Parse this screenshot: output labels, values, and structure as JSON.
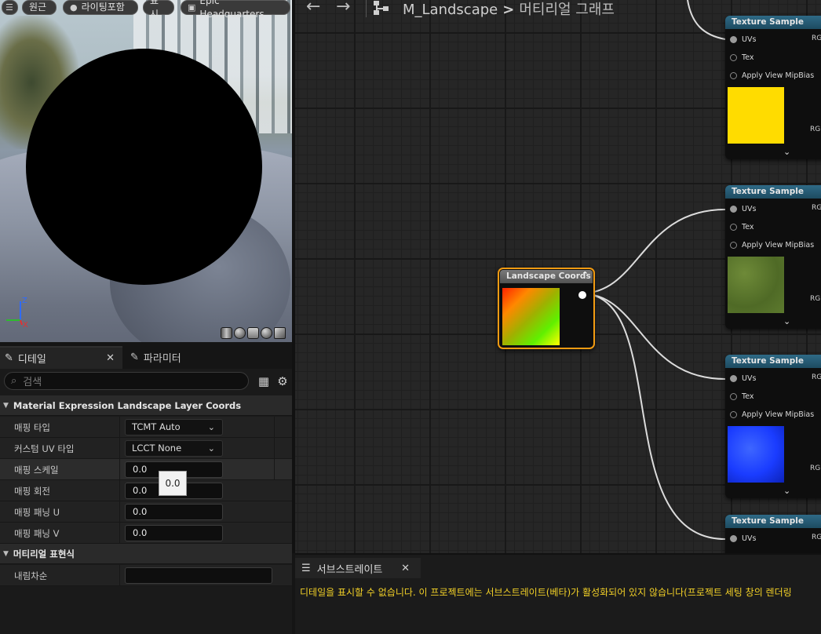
{
  "viewport": {
    "buttons": [
      {
        "label": "",
        "icon": "hamburger-menu-icon"
      },
      {
        "label": "원근",
        "icon": "perspective-icon"
      },
      {
        "label": "라이팅포함",
        "icon": "lit-sphere-icon"
      },
      {
        "label": "표시",
        "icon": ""
      },
      {
        "label": "Epic Headquarters",
        "icon": "image-icon"
      }
    ],
    "axis_labels": {
      "z": "Z",
      "x": "X"
    },
    "preview_shapes": [
      "cylinder-icon",
      "sphere-icon",
      "plane-icon",
      "sphere-icon",
      "cube-icon"
    ]
  },
  "details": {
    "tab_details": "디테일",
    "tab_parameters": "파라미터",
    "search_placeholder": "검색",
    "category1": "Material Expression Landscape Layer Coords",
    "rows": [
      {
        "label": "매핑 타입",
        "value": "TCMT Auto"
      },
      {
        "label": "커스텀 UV 타입",
        "value": "LCCT None"
      },
      {
        "label": "매핑 스케일",
        "value": "0.0"
      },
      {
        "label": "매핑 회전",
        "value": "0.0"
      },
      {
        "label": "매핑 패닝 U",
        "value": "0.0"
      },
      {
        "label": "매핑 패닝 V",
        "value": "0.0"
      }
    ],
    "tooltip": "0.0",
    "category2": "머티리얼 표현식",
    "desc_label": "내림차순",
    "desc_value": ""
  },
  "graph": {
    "breadcrumb_root": "M_Landscape",
    "breadcrumb_sep": ">",
    "breadcrumb_current": "머티리얼 그래프",
    "lc_node_title": "Landscape Coords",
    "texture_nodes": [
      {
        "title": "Texture Sample",
        "pins": [
          "UVs",
          "Tex",
          "Apply View MipBias"
        ],
        "out_top": "RG",
        "out_rgb": "RGB",
        "swatch_color": "#ffdc00"
      },
      {
        "title": "Texture Sample",
        "pins": [
          "UVs",
          "Tex",
          "Apply View MipBias"
        ],
        "out_top": "RG",
        "out_rgb": "RGB",
        "swatch_color": "#5d7a2e"
      },
      {
        "title": "Texture Sample",
        "pins": [
          "UVs",
          "Tex",
          "Apply View MipBias"
        ],
        "out_top": "RG",
        "out_rgb": "RGB",
        "swatch_color": "#1a3cff"
      },
      {
        "title": "Texture Sample",
        "pins": [
          "UVs"
        ],
        "out_top": "RG",
        "out_rgb": "",
        "swatch_color": ""
      }
    ]
  },
  "substrate": {
    "tab": "서브스트레이트",
    "message": "디테일을 표시할 수 없습니다. 이 프로젝트에는 서브스트레이트(베타)가 활성화되어 있지 않습니다(프로젝트 세팅 창의 렌더링"
  }
}
